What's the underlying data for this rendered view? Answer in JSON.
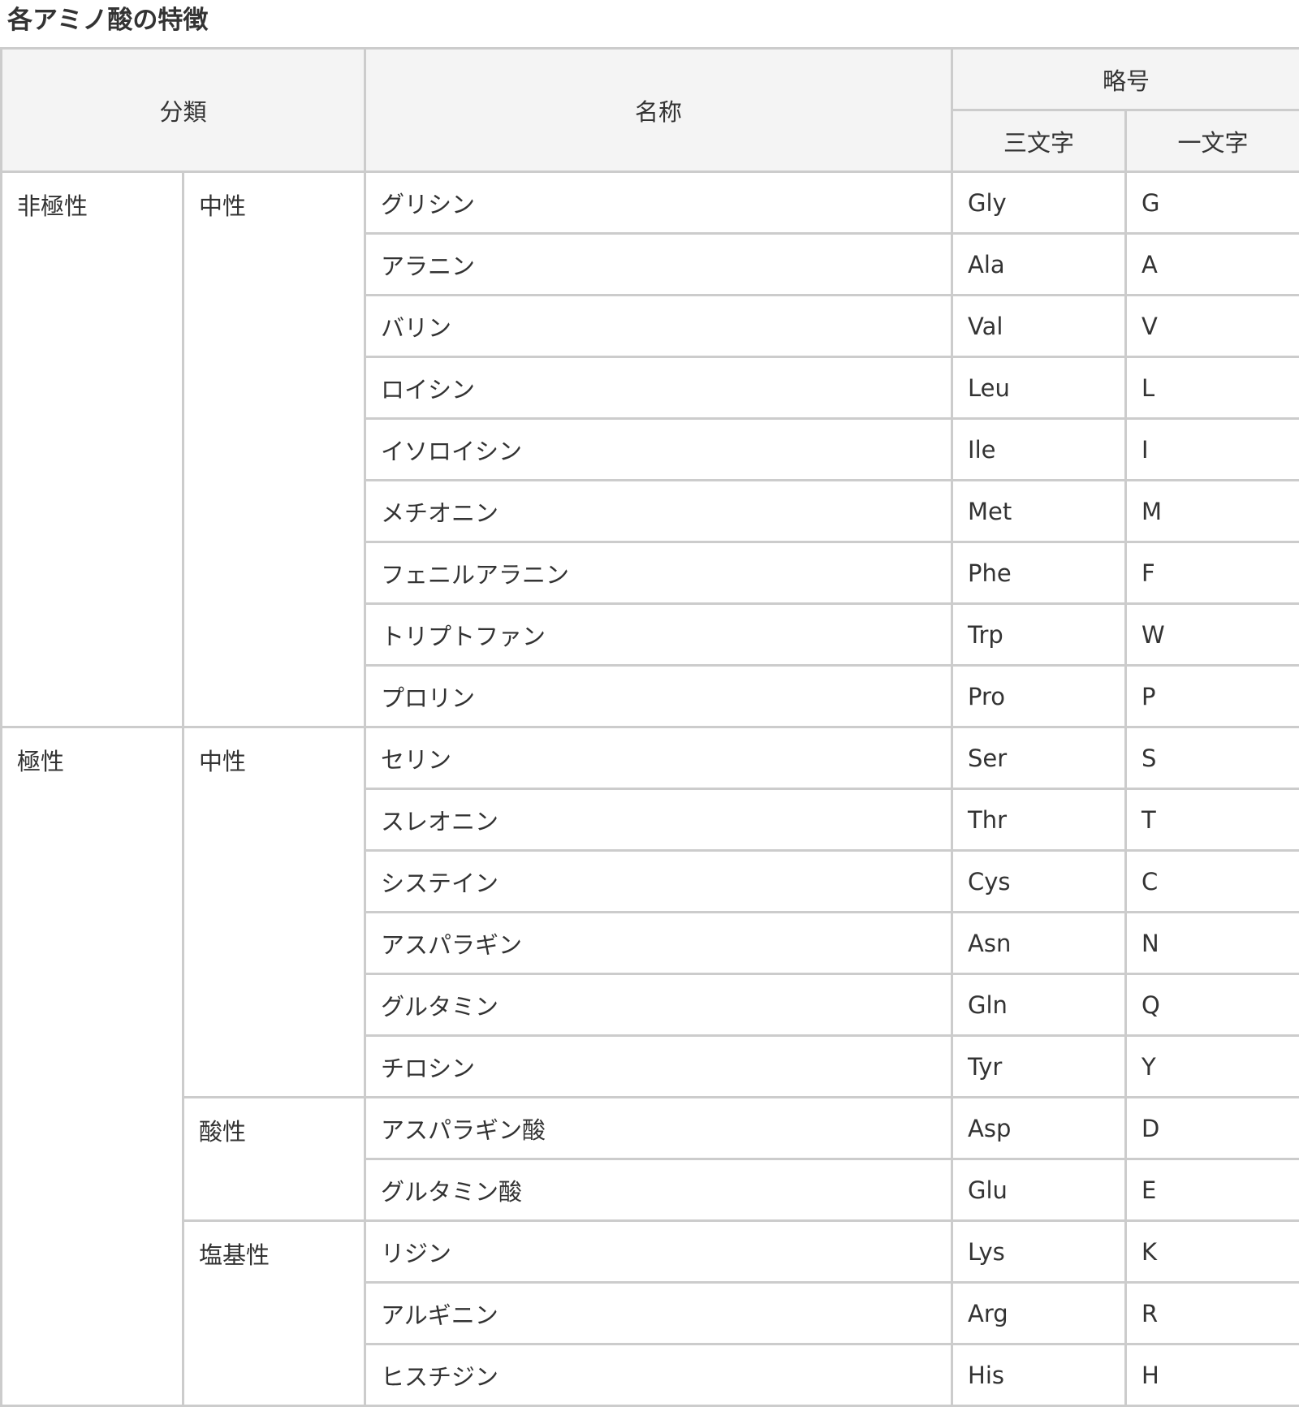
{
  "title": "各アミノ酸の特徴",
  "headers": {
    "classification": "分類",
    "name": "名称",
    "abbreviation": "略号",
    "three_letter": "三文字",
    "one_letter": "一文字"
  },
  "groups": [
    {
      "polarity": "非極性",
      "subgroups": [
        {
          "charge": "中性",
          "rows": [
            {
              "name": "グリシン",
              "three": "Gly",
              "one": "G"
            },
            {
              "name": "アラニン",
              "three": "Ala",
              "one": "A"
            },
            {
              "name": "バリン",
              "three": "Val",
              "one": "V"
            },
            {
              "name": "ロイシン",
              "three": "Leu",
              "one": "L"
            },
            {
              "name": "イソロイシン",
              "three": "Ile",
              "one": "I"
            },
            {
              "name": "メチオニン",
              "three": "Met",
              "one": "M"
            },
            {
              "name": "フェニルアラニン",
              "three": "Phe",
              "one": "F"
            },
            {
              "name": "トリプトファン",
              "three": "Trp",
              "one": "W"
            },
            {
              "name": "プロリン",
              "three": "Pro",
              "one": "P"
            }
          ]
        }
      ]
    },
    {
      "polarity": "極性",
      "subgroups": [
        {
          "charge": "中性",
          "rows": [
            {
              "name": "セリン",
              "three": "Ser",
              "one": "S"
            },
            {
              "name": "スレオニン",
              "three": "Thr",
              "one": "T"
            },
            {
              "name": "システイン",
              "three": "Cys",
              "one": "C"
            },
            {
              "name": "アスパラギン",
              "three": "Asn",
              "one": "N"
            },
            {
              "name": "グルタミン",
              "three": "Gln",
              "one": "Q"
            },
            {
              "name": "チロシン",
              "three": "Tyr",
              "one": "Y"
            }
          ]
        },
        {
          "charge": "酸性",
          "rows": [
            {
              "name": "アスパラギン酸",
              "three": "Asp",
              "one": "D"
            },
            {
              "name": "グルタミン酸",
              "three": "Glu",
              "one": "E"
            }
          ]
        },
        {
          "charge": "塩基性",
          "rows": [
            {
              "name": "リジン",
              "three": "Lys",
              "one": "K"
            },
            {
              "name": "アルギニン",
              "three": "Arg",
              "one": "R"
            },
            {
              "name": "ヒスチジン",
              "three": "His",
              "one": "H"
            }
          ]
        }
      ]
    }
  ]
}
